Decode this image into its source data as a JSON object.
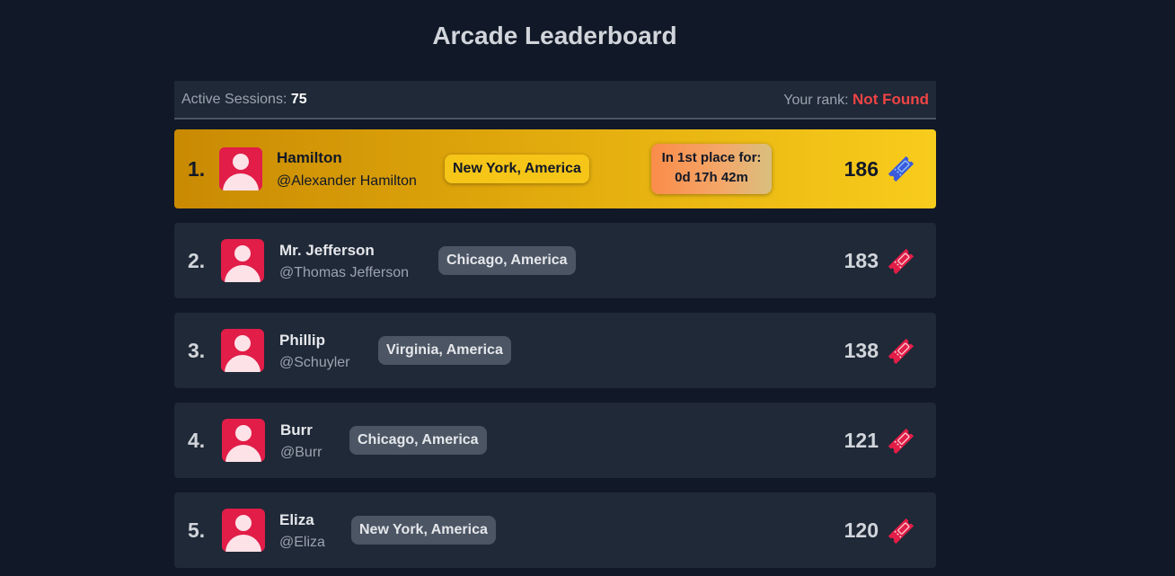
{
  "header": {
    "title": "Arcade Leaderboard"
  },
  "stats": {
    "active_label": "Active Sessions:",
    "active_value": "75",
    "rank_label": "Your rank:",
    "rank_value": "Not Found"
  },
  "first_place": {
    "line1": "In 1st place for:",
    "line2": "0d 17h 42m"
  },
  "colors": {
    "ticket_first": "#3b5bdb",
    "ticket_other": "#e11d48",
    "avatar_bg": "#e11d48"
  },
  "entries": [
    {
      "rank": "1.",
      "name": "Hamilton",
      "handle": "@Alexander Hamilton",
      "location": "New York, America",
      "score": "186",
      "icon": "ticket-icon"
    },
    {
      "rank": "2.",
      "name": "Mr. Jefferson",
      "handle": "@Thomas Jefferson",
      "location": "Chicago, America",
      "score": "183",
      "icon": "ticket-icon"
    },
    {
      "rank": "3.",
      "name": "Phillip",
      "handle": "@Schuyler",
      "location": "Virginia, America",
      "score": "138",
      "icon": "ticket-icon"
    },
    {
      "rank": "4.",
      "name": "Burr",
      "handle": "@Burr",
      "location": "Chicago, America",
      "score": "121",
      "icon": "ticket-icon"
    },
    {
      "rank": "5.",
      "name": "Eliza",
      "handle": "@Eliza",
      "location": "New York, America",
      "score": "120",
      "icon": "ticket-icon"
    }
  ]
}
